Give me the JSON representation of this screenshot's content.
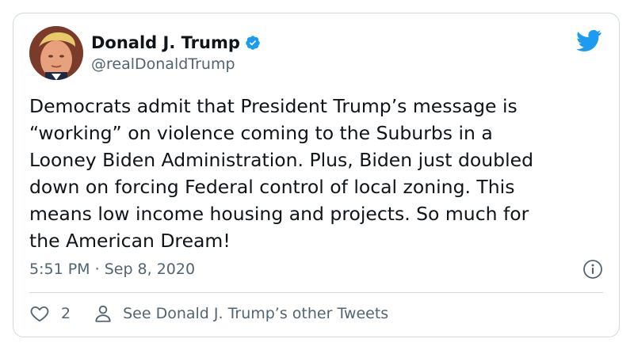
{
  "author": {
    "display_name": "Donald J. Trump",
    "handle": "@realDonaldTrump",
    "verified": true,
    "avatar_icon": "profile-photo"
  },
  "tweet": {
    "text": "Democrats admit that President Trump’s message is\n“working” on violence coming to the Suburbs in a\nLooney Biden Administration. Plus, Biden just doubled\ndown on forcing Federal control of local zoning. This\nmeans low income housing and projects. So much for\nthe American Dream!",
    "time": "5:51 PM",
    "separator": "·",
    "date": "Sep 8, 2020"
  },
  "actions": {
    "like_icon": "heart-icon",
    "like_count": "2",
    "profile_icon": "person-icon",
    "other_tweets_label": "See Donald J. Trump’s other Tweets"
  },
  "colors": {
    "brand": "#1d9bf0",
    "text": "#0f1419",
    "secondary": "#536471",
    "border": "#cfd9de"
  }
}
